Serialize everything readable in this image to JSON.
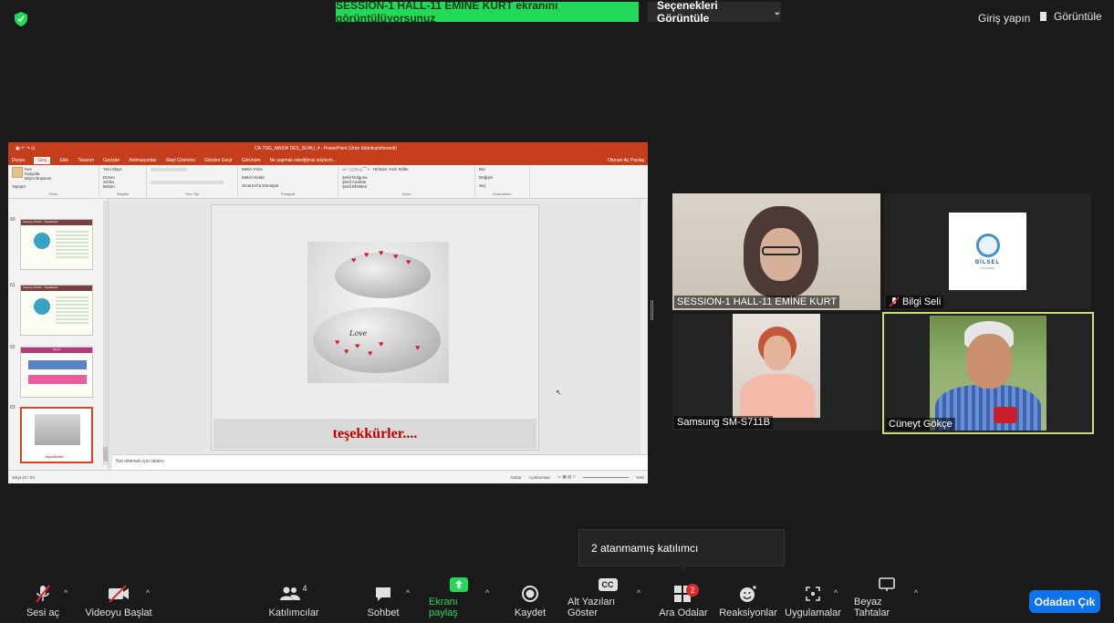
{
  "topbar": {
    "share_banner": "SESSION-1 HALL-11 EMİNE KURT ekranını görüntülüyorsunuz",
    "view_options_label": "Seçenekleri Görüntüle",
    "signin_label": "Giriş yapın",
    "view_label": "Görüntüle"
  },
  "shared_screen": {
    "window_title": "CA-TSG_MASW DES_SUNU_4 - PowerPoint (Ürün Etkinleştirilemedi)",
    "tabs": [
      "Dosya",
      "Giriş",
      "Ekle",
      "Tasarım",
      "Geçişler",
      "Animasyonlar",
      "Slayt Gösterisi",
      "Gözden Geçir",
      "Görünüm"
    ],
    "active_tab": "Giriş",
    "tell_me": "Ne yapmak istediğinizi söyleyin...",
    "signin_share": "Oturum Aç  Paylaş",
    "ribbon_groups": [
      "Pano",
      "Slaytlar",
      "Yazı Tipi",
      "Paragraf",
      "Çizim",
      "Düzenleme"
    ],
    "ribbon_items": {
      "paste": "Yapıştır",
      "cut": "Kes",
      "copy": "Kopyala",
      "format_painter": "Biçim Boyacısı",
      "new_slide": "Yeni Slayt",
      "layout": "Düzen",
      "reset": "Sıfırla",
      "section": "Bölüm",
      "text_direction": "Metin Yönü",
      "align_text": "Metni Hizala",
      "smartart": "SmartArt'a Dönüştür",
      "arrange": "Yerleştir",
      "quick_styles": "Hızlı Stiller",
      "shape_fill": "Şekil Dolgusu",
      "shape_outline": "Şekil Anahatı",
      "shape_effects": "Şekil Efektleri",
      "find": "Bul",
      "replace": "Değiştir",
      "select": "Seç"
    },
    "slide_numbers": [
      "60",
      "61",
      "62",
      "63"
    ],
    "thumb_header_text": "Kapanış Sözleri - Teşekkürler",
    "thumb_pink_header": "Sonuç",
    "selected_thumb_label": "teşekkürler....",
    "slide_caption": "teşekkürler....",
    "stone_text": "Love",
    "notes_placeholder": "Not eklemek için tıklatın",
    "status_left": "Slayt 63 / 63",
    "status_notes": "Notlar",
    "status_comments": "Açıklamalar",
    "zoom": "%60"
  },
  "participants": [
    {
      "name": "SESSION-1 HALL-11 EMİNE KURT"
    },
    {
      "name": "Bilgi Seli",
      "logo_text": "BİLSEL",
      "logo_sub": "KONGRESİ"
    },
    {
      "name": "Samsung SM-S711B"
    },
    {
      "name": "Cüneyt Gökçe"
    }
  ],
  "tooltip": "2 atanmamış katılımcı",
  "toolbar": {
    "mute": "Sesi aç",
    "video": "Videoyu Başlat",
    "participants": "Katılımcılar",
    "participant_count": "4",
    "chat": "Sohbet",
    "share": "Ekranı paylaş",
    "record": "Kaydet",
    "captions": "Alt Yazıları Göster",
    "cc": "CC",
    "breakout": "Ara Odalar",
    "breakout_badge": "2",
    "reactions": "Reaksiyonlar",
    "apps": "Uygulamalar",
    "whiteboard": "Beyaz Tahtalar",
    "leave": "Odadan Çık"
  },
  "colors": {
    "banner_green": "#23d959",
    "ppt_red": "#c43e1c",
    "leave_blue": "#0e72ed",
    "active_speaker": "#c7e076",
    "badge_red": "#e02828"
  }
}
